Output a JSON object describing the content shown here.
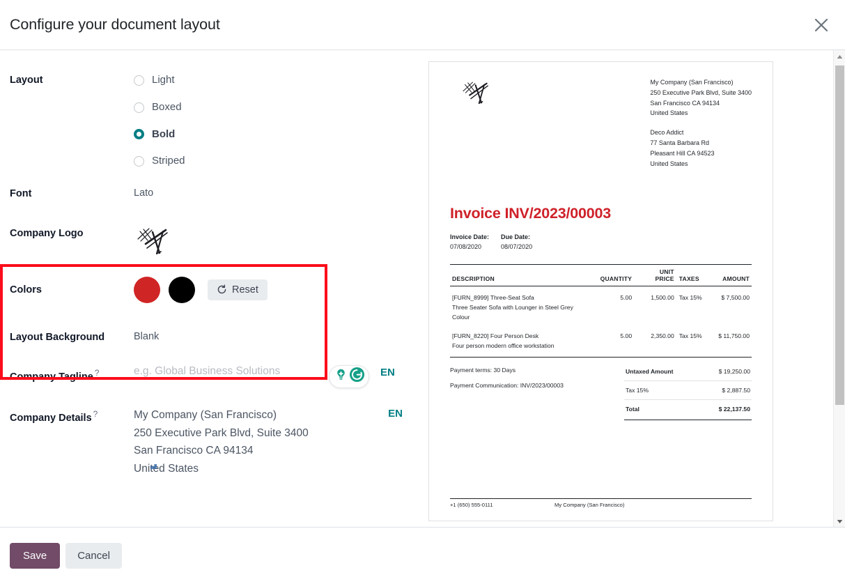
{
  "dialog": {
    "title": "Configure your document layout",
    "close_label": "×"
  },
  "form": {
    "layout": {
      "label": "Layout",
      "options": [
        {
          "label": "Light",
          "selected": false
        },
        {
          "label": "Boxed",
          "selected": false
        },
        {
          "label": "Bold",
          "selected": true
        },
        {
          "label": "Striped",
          "selected": false
        }
      ]
    },
    "font": {
      "label": "Font",
      "value": "Lato"
    },
    "company_logo": {
      "label": "Company Logo",
      "icon": "signature-sketch-logo"
    },
    "colors": {
      "label": "Colors",
      "primary": "#D02525",
      "secondary": "#000000",
      "reset_label": "Reset",
      "reset_icon": "refresh-icon"
    },
    "layout_background": {
      "label": "Layout Background",
      "value": "Blank"
    },
    "company_tagline": {
      "label": "Company Tagline",
      "help": "?",
      "value": "",
      "placeholder": "e.g. Global Business Solutions",
      "lang": "EN",
      "assistant_icons": [
        "grammarly-suggestion-icon",
        "grammarly-logo-icon"
      ]
    },
    "company_details": {
      "label": "Company Details",
      "help": "?",
      "lang": "EN",
      "value": "My Company (San Francisco)\n250 Executive Park Blvd, Suite 3400\nSan Francisco CA 94134\nUnited States"
    },
    "highlight_box_color": "#FC0D1B"
  },
  "preview": {
    "company_address": [
      "My Company (San Francisco)",
      "250 Executive Park Blvd, Suite 3400",
      "San Francisco CA 94134",
      "United States"
    ],
    "customer_address": [
      "Deco Addict",
      "77 Santa Barbara Rd",
      "Pleasant Hill CA 94523",
      "United States"
    ],
    "invoice_title": "Invoice INV/2023/00003",
    "invoice_title_color": "#CF2129",
    "dates": [
      {
        "label": "Invoice Date:",
        "value": "07/08/2020"
      },
      {
        "label": "Due Date:",
        "value": "08/07/2020"
      }
    ],
    "table": {
      "headers": {
        "description": "DESCRIPTION",
        "quantity": "QUANTITY",
        "unit_price_line1": "UNIT",
        "unit_price_line2": "PRICE",
        "taxes": "TAXES",
        "amount": "AMOUNT"
      },
      "rows": [
        {
          "description": "[FURN_8999] Three-Seat Sofa",
          "sub_description": "Three Seater Sofa with Lounger in Steel Grey Colour",
          "quantity": "5.00",
          "unit_price": "1,500.00",
          "taxes": "Tax 15%",
          "amount": "$ 7,500.00"
        },
        {
          "description": "[FURN_8220] Four Person Desk",
          "sub_description": "Four person modern office workstation",
          "quantity": "5.00",
          "unit_price": "2,350.00",
          "taxes": "Tax 15%",
          "amount": "$ 11,750.00"
        }
      ]
    },
    "payment_terms": "Payment terms: 30 Days",
    "payment_communication": "Payment Communication: INV/2023/00003",
    "totals": [
      {
        "name": "Untaxed Amount",
        "value": "$ 19,250.00"
      },
      {
        "name": "Tax 15%",
        "value": "$ 2,887.50"
      },
      {
        "name": "Total",
        "value": "$ 22,137.50"
      }
    ],
    "footer": {
      "phone": "+1 (650) 555-0111",
      "company": "My Company (San Francisco)"
    }
  },
  "footer": {
    "save_label": "Save",
    "cancel_label": "Cancel"
  }
}
